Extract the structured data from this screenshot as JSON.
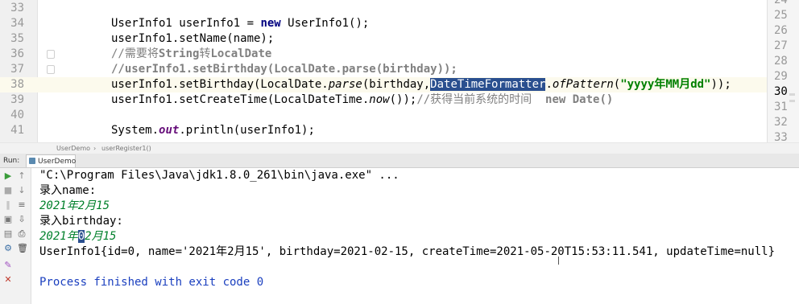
{
  "editor": {
    "lines": [
      {
        "num": "33",
        "tokens": []
      },
      {
        "num": "34",
        "tokens": [
          {
            "t": "UserInfo1 userInfo1 = ",
            "c": ""
          },
          {
            "t": "new",
            "c": "kw"
          },
          {
            "t": " UserInfo1();",
            "c": ""
          }
        ]
      },
      {
        "num": "35",
        "tokens": [
          {
            "t": "userInfo1.setName(name);",
            "c": ""
          }
        ]
      },
      {
        "num": "36",
        "tokens": [
          {
            "t": "//需要将",
            "c": "comment"
          },
          {
            "t": "String",
            "c": "comment-b"
          },
          {
            "t": "转",
            "c": "comment"
          },
          {
            "t": "LocalDate",
            "c": "comment-b"
          }
        ]
      },
      {
        "num": "37",
        "tokens": [
          {
            "t": "//userInfo1.setBirthday(LocalDate.parse(birthday));",
            "c": "comment-b"
          }
        ]
      },
      {
        "num": "38",
        "current": true,
        "tokens": [
          {
            "t": "userInfo1.setBirthday(LocalDate.",
            "c": ""
          },
          {
            "t": "parse",
            "c": "italic"
          },
          {
            "t": "(birthday,",
            "c": ""
          },
          {
            "t": "DateTimeFormatter",
            "c": "sel"
          },
          {
            "t": ".",
            "c": ""
          },
          {
            "t": "ofPattern",
            "c": "italic"
          },
          {
            "t": "(",
            "c": ""
          },
          {
            "t": "\"yyyy年MM月dd\"",
            "c": "str"
          },
          {
            "t": "));",
            "c": ""
          }
        ]
      },
      {
        "num": "39",
        "tokens": [
          {
            "t": "userInfo1.setCreateTime(LocalDateTime.",
            "c": ""
          },
          {
            "t": "now",
            "c": "italic"
          },
          {
            "t": "());",
            "c": ""
          },
          {
            "t": "//获得当前系统的时间  ",
            "c": "comment"
          },
          {
            "t": "new Date()",
            "c": "comment-b"
          }
        ]
      },
      {
        "num": "40",
        "tokens": []
      },
      {
        "num": "41",
        "tokens": [
          {
            "t": "System.",
            "c": ""
          },
          {
            "t": "out",
            "c": "field"
          },
          {
            "t": ".println(userInfo1);",
            "c": ""
          }
        ]
      }
    ],
    "right_numbers": [
      "24",
      "25",
      "26",
      "27",
      "28",
      "29",
      "30",
      "31",
      "32",
      "33"
    ],
    "right_current": "30"
  },
  "breadcrumb": {
    "class_name": "UserDemo",
    "method_name": "userRegister1()"
  },
  "run": {
    "label": "Run:",
    "tab_label": "UserDemo"
  },
  "console": {
    "lines": [
      {
        "tokens": [
          {
            "t": "\"C:\\Program Files\\Java\\jdk1.8.0_261\\bin\\java.exe\" ...",
            "c": ""
          }
        ]
      },
      {
        "tokens": [
          {
            "t": "录入name:",
            "c": ""
          }
        ]
      },
      {
        "tokens": [
          {
            "t": "2021年2月15",
            "c": "green-i"
          }
        ]
      },
      {
        "tokens": [
          {
            "t": "录入birthday:",
            "c": ""
          }
        ]
      },
      {
        "tokens": [
          {
            "t": "2021年",
            "c": "green-i"
          },
          {
            "t": "0",
            "c": "cursor-sel"
          },
          {
            "t": "2月15",
            "c": "green-i"
          }
        ]
      },
      {
        "tokens": [
          {
            "t": "UserInfo1{id=0, name='2021年2月15', birthday=2021-02-15, createTime=2021-05-20T15:53:11.541, updateTime=null}",
            "c": ""
          }
        ]
      },
      {
        "tokens": []
      },
      {
        "tokens": [
          {
            "t": "Process finished with exit code 0",
            "c": "blue"
          }
        ]
      }
    ]
  },
  "icons": {
    "run": "run-icon",
    "stop": "stop-icon",
    "up": "scroll-up-icon",
    "down": "scroll-down-icon",
    "pause": "pause-icon",
    "soft-wrap": "soft-wrap-icon",
    "print": "print-icon",
    "clear": "trash-icon",
    "pin": "pin-icon",
    "close": "close-icon"
  },
  "colors": {
    "keyword": "#000080",
    "comment": "#808080",
    "string": "#008000",
    "selection": "#2a4f8f",
    "console_input": "#00802b",
    "console_exit": "#1a3fbf",
    "current_line": "#fcfaed"
  }
}
